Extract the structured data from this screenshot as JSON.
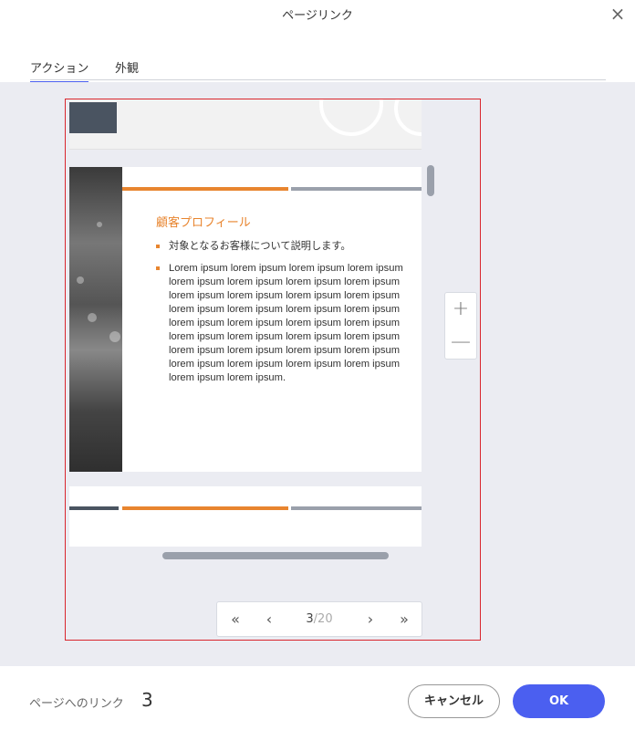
{
  "dialog": {
    "title": "ページリンク",
    "close_icon": "×"
  },
  "tabs": [
    {
      "label": "アクション",
      "active": true
    },
    {
      "label": "外観",
      "active": false
    }
  ],
  "slide": {
    "heading": "顧客プロフィール",
    "bullets": [
      "対象となるお客様について説明します。",
      "Lorem ipsum lorem ipsum lorem ipsum lorem ipsum lorem ipsum lorem ipsum lorem ipsum lorem ipsum lorem ipsum lorem ipsum lorem ipsum lorem ipsum lorem ipsum lorem ipsum lorem ipsum lorem ipsum lorem ipsum lorem ipsum lorem ipsum lorem ipsum lorem ipsum lorem ipsum lorem ipsum lorem ipsum lorem ipsum lorem ipsum lorem ipsum lorem ipsum lorem ipsum lorem ipsum lorem ipsum lorem ipsum lorem ipsum lorem ipsum."
    ]
  },
  "zoom": {
    "in_icon": "+",
    "out_icon": "—"
  },
  "pager": {
    "first_icon": "«",
    "prev_icon": "‹",
    "next_icon": "›",
    "last_icon": "»",
    "current": "3",
    "total": "/20"
  },
  "footer": {
    "link_label": "ページへのリンク",
    "link_value": "3",
    "cancel_label": "キャンセル",
    "ok_label": "OK"
  },
  "colors": {
    "accent": "#4b5ff0",
    "frame_border": "#d9262d",
    "slide_orange": "#e8852f",
    "slide_gray": "#9aa0ab"
  }
}
